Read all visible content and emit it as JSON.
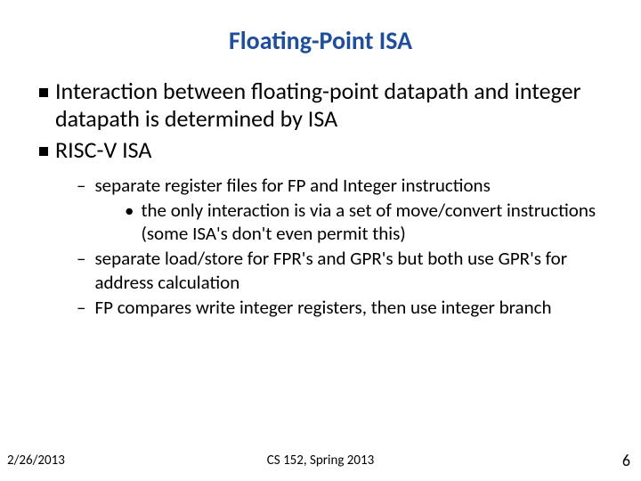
{
  "title": "Floating-Point ISA",
  "bullets": {
    "b1": "Interaction between floating-point datapath and integer datapath is determined by ISA",
    "b2": "RISC-V ISA",
    "sub1": "separate register files for FP and Integer instructions",
    "sub1dot1": "the only interaction is via a set of move/convert instructions  (some ISA's don't even permit this)",
    "sub2": "separate load/store for FPR's and GPR's but both use GPR's for address calculation",
    "sub3": "FP compares write integer registers, then use integer branch"
  },
  "footer": {
    "date": "2/26/2013",
    "course": "CS 152, Spring 2013",
    "page": "6"
  }
}
